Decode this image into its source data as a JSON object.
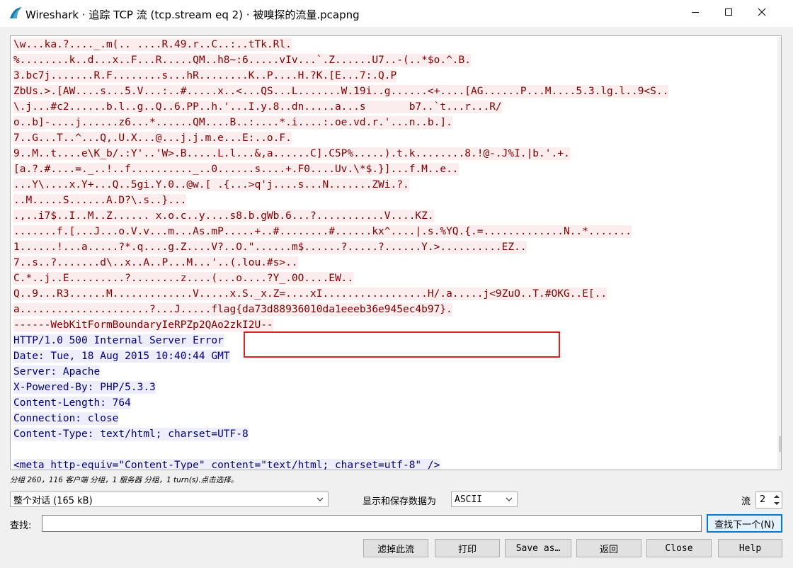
{
  "window": {
    "title": "Wireshark · 追踪 TCP 流 (tcp.stream eq 2) · 被嗅探的流量.pcapng",
    "app_icon": "wireshark-fin-icon"
  },
  "stream": {
    "client_lines": [
      "\\w...ka.?...._.m(.. ....R.49.r..C..:..tTk.Rl.",
      "%........k..d...x..F...R.....QM..h8~:6.....vIv...`.Z......U7..-(..*$o.^.B.",
      "3.bc7j.......R.F........s...hR........K..P....H.?K.[E...7:.Q.P",
      "ZbUs.>.[AW....s...5.V...:..#.....x..<...QS...L.......W.19i..g......<+....[AG......P...M....5.3.lg.l..9<S..",
      "\\.j...#c2......b.l..g..Q..6.PP..h.'...I.y.8..dn.....a...s       b7..`t...r...R/",
      "o..b]-....j......z6...*......QM....B..:....*.i....:.oe.vd.r.'...n..b.].",
      "7..G...T..^...Q,.U.X...@...j.j.m.e...E:..o.F.",
      "9..M..t....e\\K_b/.:Y'..'W>.B.....L.l...&,a......C].C5P%.....).t.k........8.!@-.J%I.|b.'.+.",
      "[a.?.#....=._..!..f.........._..0......s....+.F0....Uv.\\*$.}]...f.M..e..",
      "...Y\\....x.Y+...Q..5gi.Y.0..@w.[ .{...>q'j....s...N.......ZWi.?.",
      "..M.....S......A.D?\\.s..}...",
      ".,..i7$..I..M..Z...... x.o.c..y....s8.b.gWb.6...?...........V....KZ.",
      ".......f.[...J...o.V.v...m...As.mP.....+..#........#......kx^....|.s.%YQ.{.=.............N..*.......",
      "1......!...a.....?*.q....g.Z....V?..O.\"......m$......?.....?......Y.>..........EZ..",
      "7..s..?.......d\\..x..A..P...M...'..(.lou.#s>..",
      "C.*..j..E.........?........z....(...o....?Y_.0O....EW..",
      "Q..9...R3......M.............V.....x.S._x.Z=....xI.................H/.a.....j<9ZuO..T.#OKG..E[..",
      "a.....................?...J.....flag{da73d88936010da1eeeb36e945ec4b97}.",
      "------WebKitFormBoundaryIeRPZp2QAo2zkI2U--"
    ],
    "server_lines": [
      "HTTP/1.0 500 Internal Server Error",
      "Date: Tue, 18 Aug 2015 10:40:44 GMT",
      "Server: Apache",
      "X-Powered-By: PHP/5.3.3",
      "Content-Length: 764",
      "Connection: close",
      "Content-Type: text/html; charset=UTF-8"
    ],
    "server_lines_after_blank": [
      "<meta http-equiv=\"Content-Type\" content=\"text/html; charset=utf-8\" />"
    ]
  },
  "status_text": "分组 260，116 客户端 分组，1 服务器 分组，1 turn(s).点击选择。",
  "controls": {
    "conversation_select": "整个对话 (165 kB)",
    "format_label": "显示和保存数据为",
    "format_select": "ASCII",
    "stream_label": "流",
    "stream_value": "2",
    "find_label": "查找:",
    "find_value": "",
    "find_next": "查找下一个(N)"
  },
  "buttons": {
    "filter_out": "滤掉此流",
    "print": "打印",
    "save_as": "Save as…",
    "back": "返回",
    "close": "Close",
    "help": "Help"
  },
  "colors": {
    "client_bg": "#fbeded",
    "client_fg": "#7f0000",
    "server_bg": "#ededfb",
    "server_fg": "#00007f",
    "highlight": "#e02020"
  }
}
